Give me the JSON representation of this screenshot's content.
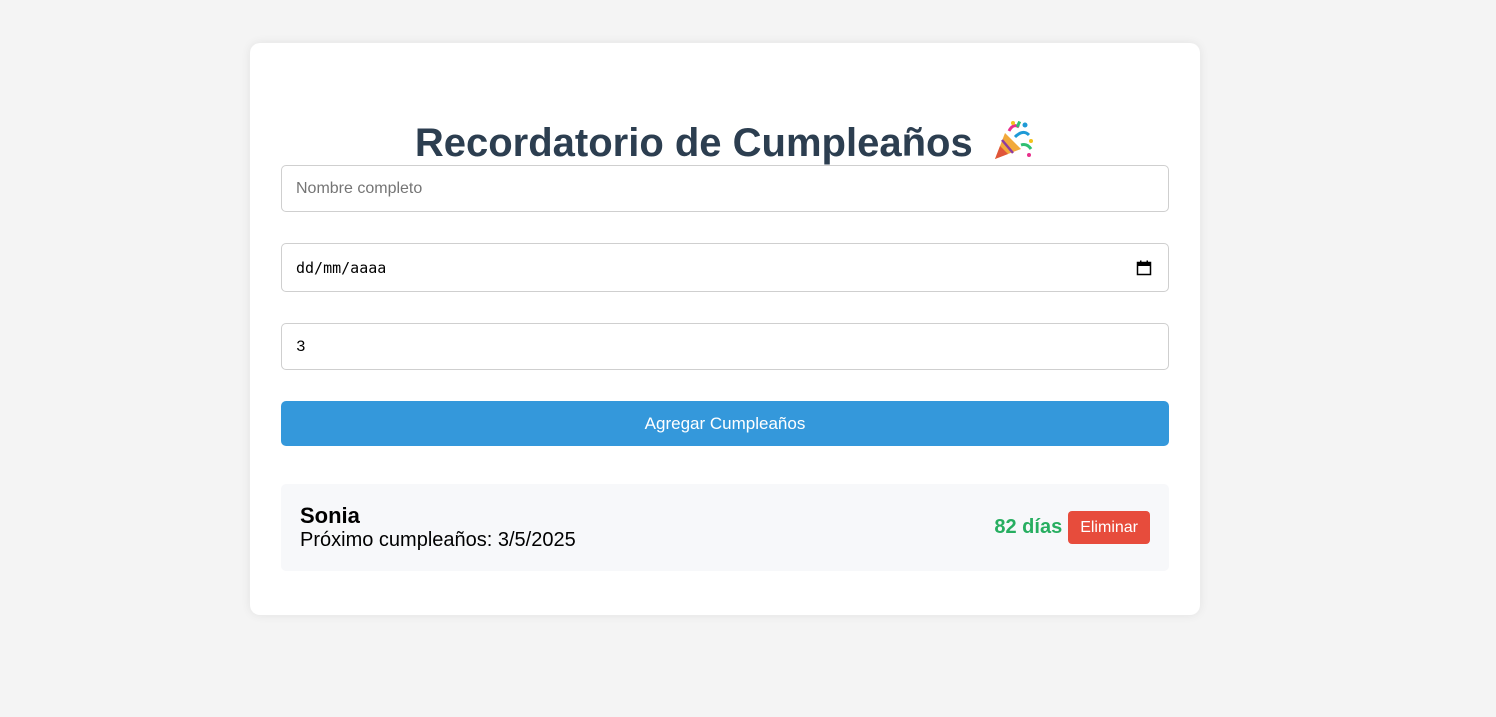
{
  "header": {
    "title": "Recordatorio de Cumpleaños",
    "icon": "party-popper-icon"
  },
  "form": {
    "name_placeholder": "Nombre completo",
    "name_value": "",
    "date_placeholder": "dd/mm/aaaa",
    "days_value": "3",
    "add_button_label": "Agregar Cumpleaños"
  },
  "birthdays": [
    {
      "name": "Sonia",
      "next_label": "Próximo cumpleaños: 3/5/2025",
      "days_left": "82 días",
      "delete_label": "Eliminar"
    }
  ],
  "colors": {
    "background": "#f4f4f4",
    "title": "#2c3e50",
    "primary": "#3498db",
    "success": "#27ae60",
    "danger": "#e74c3c"
  }
}
